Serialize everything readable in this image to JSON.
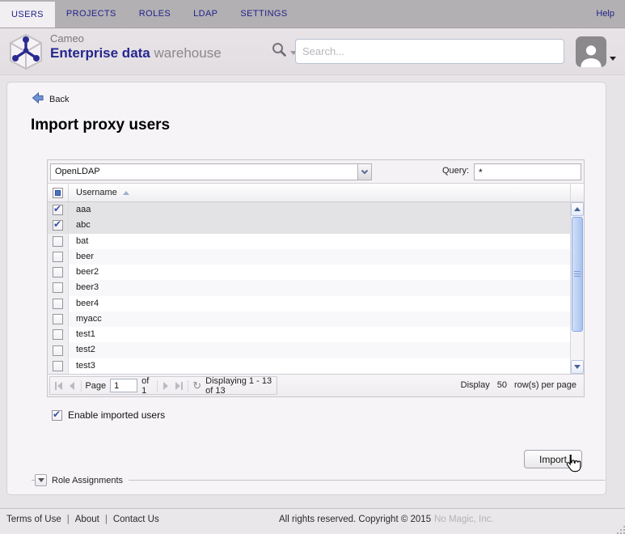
{
  "nav": {
    "items": [
      {
        "label": "USERS",
        "active": true
      },
      {
        "label": "PROJECTS",
        "active": false
      },
      {
        "label": "ROLES",
        "active": false
      },
      {
        "label": "LDAP",
        "active": false
      },
      {
        "label": "SETTINGS",
        "active": false
      }
    ],
    "help_label": "Help"
  },
  "header": {
    "brand": {
      "top": "Cameo",
      "bold": "Enterprise data",
      "light": "warehouse"
    },
    "search_placeholder": "Search..."
  },
  "page": {
    "back_label": "Back",
    "title": "Import proxy users"
  },
  "grid": {
    "source_select_value": "OpenLDAP",
    "query_label": "Query:",
    "query_value": "*",
    "column_header": "Username",
    "sort": "ascending",
    "rows": [
      {
        "name": "aaa",
        "checked": true,
        "selected": true
      },
      {
        "name": "abc",
        "checked": true,
        "selected": true
      },
      {
        "name": "bat",
        "checked": false,
        "selected": false
      },
      {
        "name": "beer",
        "checked": false,
        "selected": false
      },
      {
        "name": "beer2",
        "checked": false,
        "selected": false
      },
      {
        "name": "beer3",
        "checked": false,
        "selected": false
      },
      {
        "name": "beer4",
        "checked": false,
        "selected": false
      },
      {
        "name": "myacc",
        "checked": false,
        "selected": false
      },
      {
        "name": "test1",
        "checked": false,
        "selected": false
      },
      {
        "name": "test2",
        "checked": false,
        "selected": false
      },
      {
        "name": "test3",
        "checked": false,
        "selected": false
      }
    ],
    "pagination": {
      "page_label": "Page",
      "page_value": "1",
      "of_label": "of 1",
      "displaying": "Displaying 1 - 13 of 13",
      "display_label": "Display",
      "page_size": "50",
      "rows_per_page_label": "row(s) per page"
    }
  },
  "form": {
    "enable_checkbox_label": "Enable imported users",
    "enable_checked": true,
    "import_button_label": "Import",
    "role_assignments_label": "Role Assignments"
  },
  "footer": {
    "links": [
      {
        "label": "Terms of Use"
      },
      {
        "label": "About"
      },
      {
        "label": "Contact Us"
      }
    ],
    "separator": "|",
    "copyright_text": "All rights reserved. Copyright © 2015",
    "company_link": "No Magic, Inc."
  },
  "icons": {
    "back_arrow": "left-arrow",
    "search": "magnifier",
    "caret_down": "▼",
    "sort_asc": "▲",
    "refresh": "↻",
    "first_page": "|◀",
    "prev_page": "◀",
    "next_page": "▶",
    "last_page": "▶|",
    "checkbox_checked": "✔",
    "checkbox_indeterminate": "■",
    "avatar": "person-silhouette",
    "cursor": "pointer-hand"
  },
  "colors": {
    "nav_bg": "#b2b0b2",
    "nav_text": "#22228c",
    "active_tab_bg": "#f1eff1",
    "band_bg": "#e5e1e5",
    "page_bg": "#e7e4e7",
    "panel_bg": "#f6f4f7",
    "brand_blue": "#26268f",
    "selected_row_bg": "#e3e2e5",
    "scrollbar_thumb": "#a8c3ef",
    "check_blue": "#3552a5"
  }
}
